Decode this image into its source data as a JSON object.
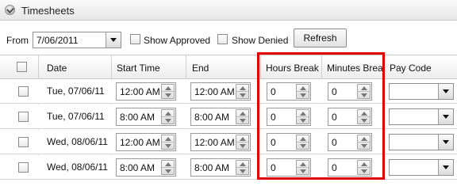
{
  "panel": {
    "title": "Timesheets",
    "icon": "clock-icon"
  },
  "toolbar": {
    "from_label": "From",
    "from_date": "7/06/2011",
    "show_approved_label": "Show Approved",
    "show_approved_checked": false,
    "show_denied_label": "Show Denied",
    "show_denied_checked": false,
    "refresh_label": "Refresh"
  },
  "grid": {
    "columns": [
      "",
      "Date",
      "Start Time",
      "End",
      "Hours Break",
      "Minutes Break",
      "Pay Code"
    ],
    "rows": [
      {
        "checked": false,
        "date": "Tue, 07/06/11",
        "start": "12:00 AM",
        "end": "12:00 AM",
        "hours_break": "0",
        "minutes_break": "0",
        "pay_code": ""
      },
      {
        "checked": false,
        "date": "Tue, 07/06/11",
        "start": "8:00 AM",
        "end": "8:00 AM",
        "hours_break": "0",
        "minutes_break": "0",
        "pay_code": ""
      },
      {
        "checked": false,
        "date": "Wed, 08/06/11",
        "start": "12:00 AM",
        "end": "12:00 AM",
        "hours_break": "0",
        "minutes_break": "0",
        "pay_code": ""
      },
      {
        "checked": false,
        "date": "Wed, 08/06/11",
        "start": "8:00 AM",
        "end": "8:00 AM",
        "hours_break": "0",
        "minutes_break": "0",
        "pay_code": ""
      }
    ]
  },
  "colors": {
    "highlight": "#e00000",
    "header_bg": "#ededed",
    "border": "#c8c8c8"
  }
}
